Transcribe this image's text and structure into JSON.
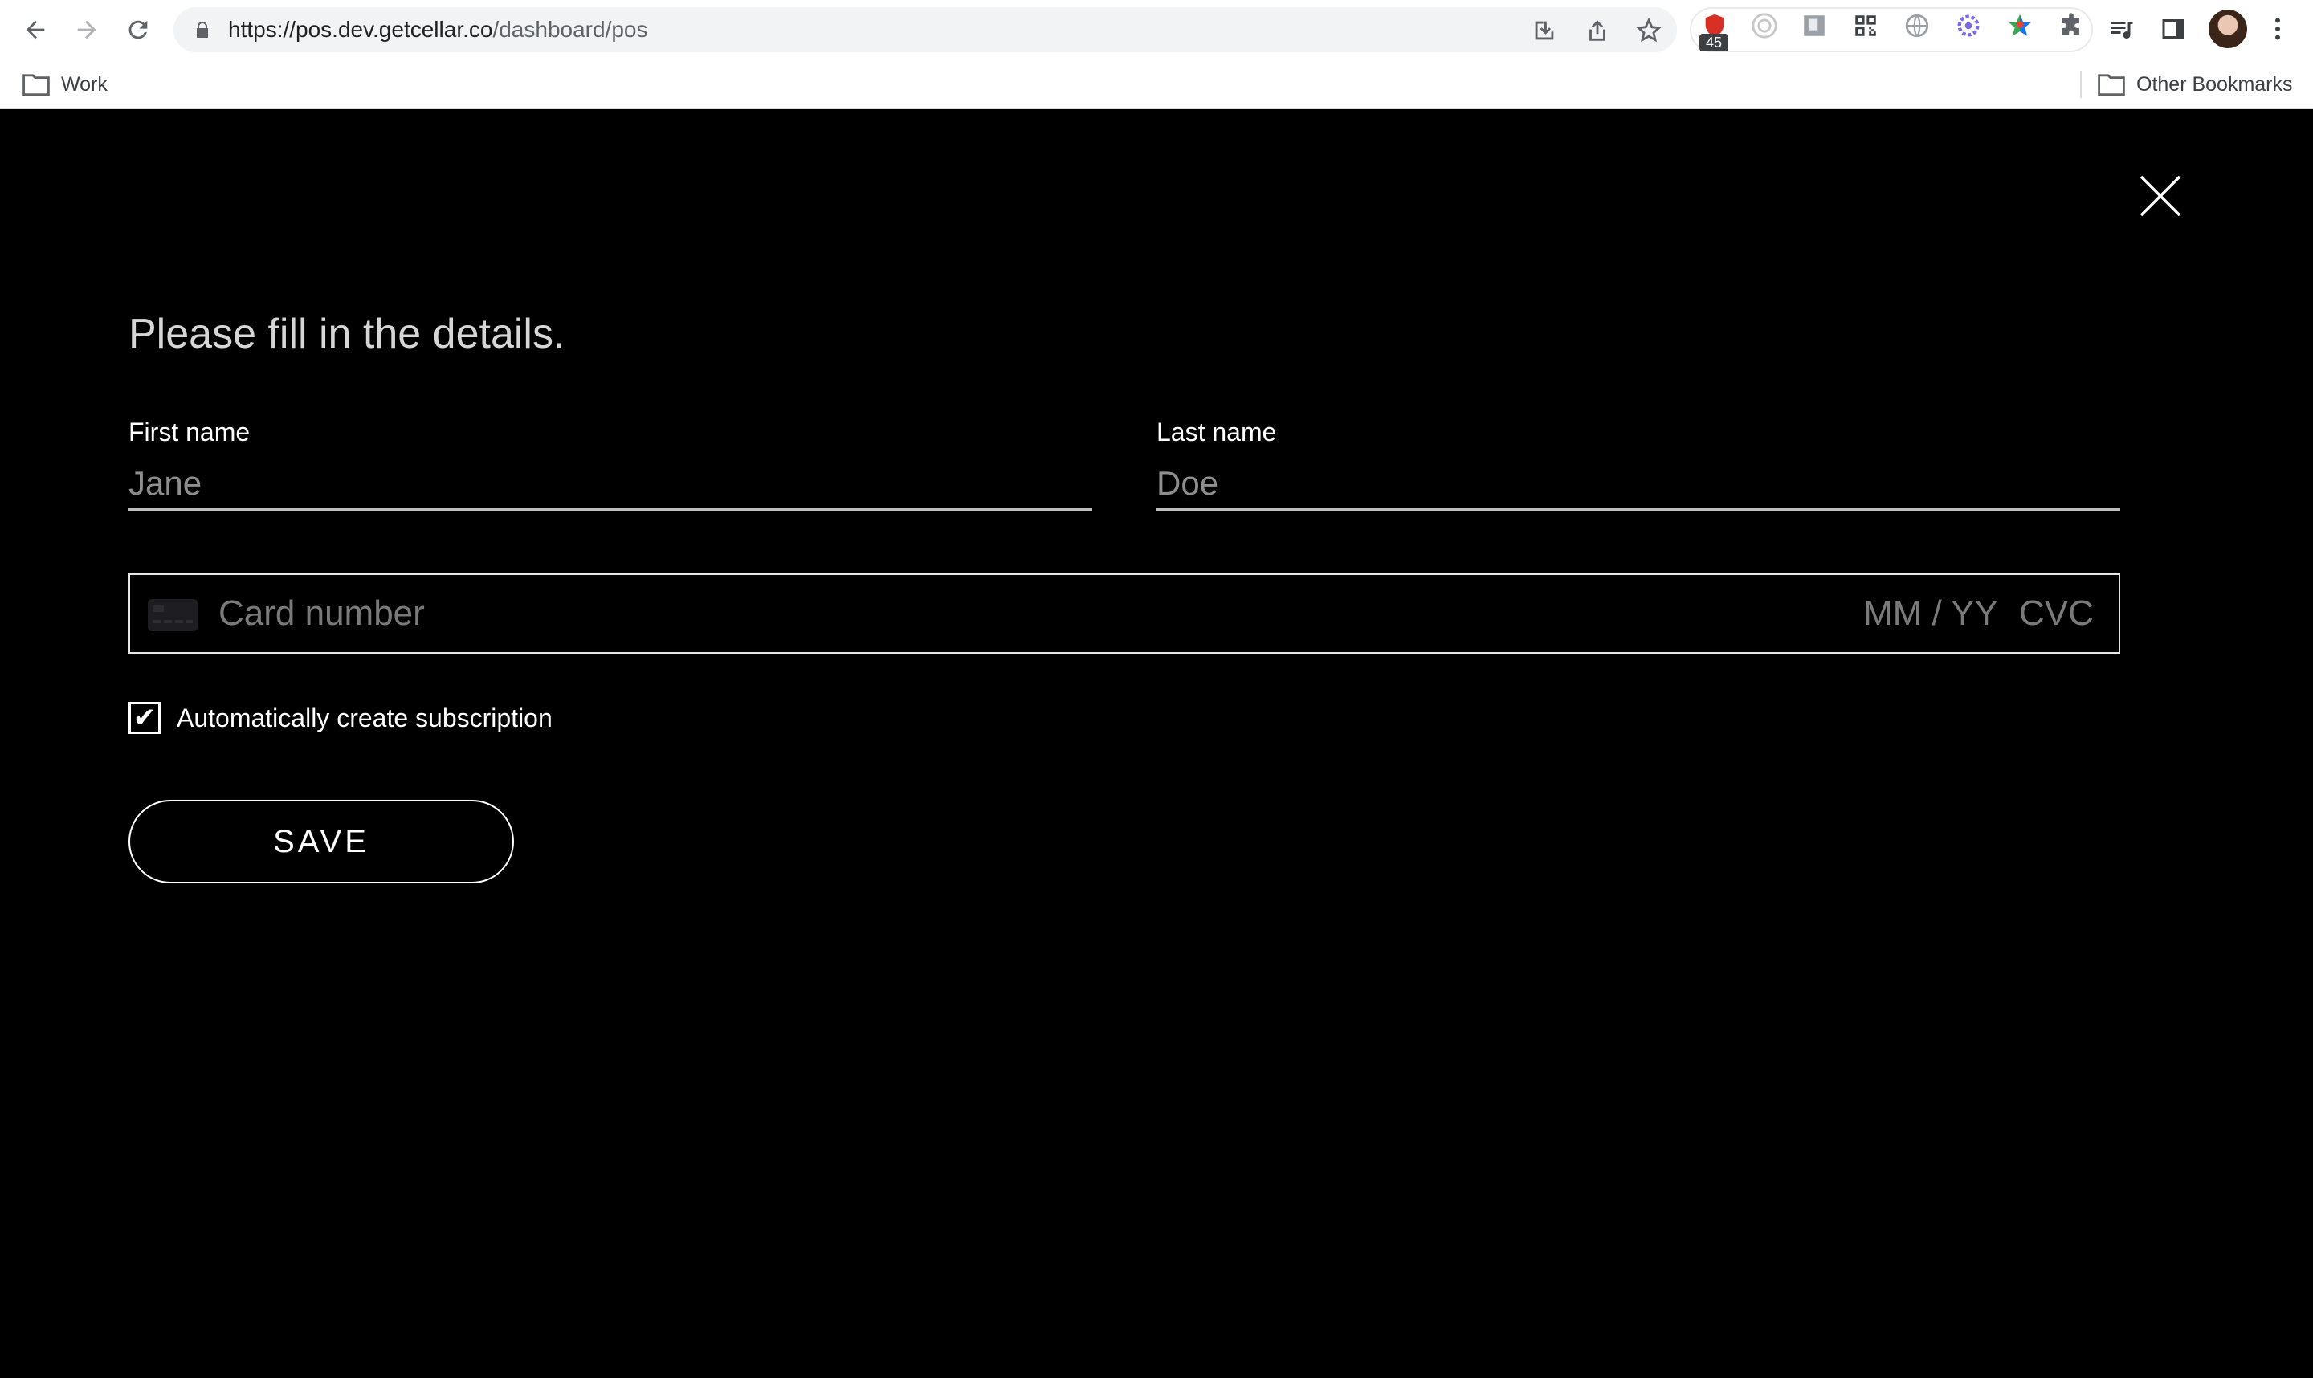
{
  "browser": {
    "url_host": "https://pos.dev.getcellar.co",
    "url_path": "/dashboard/pos",
    "extension_badge": "45",
    "icons": [
      "back-icon",
      "forward-icon",
      "reload-icon",
      "lock-icon",
      "install-icon",
      "share-icon",
      "star-icon",
      "extensions-puzzle-icon",
      "media-icon",
      "side-panel-icon",
      "kebab-menu-icon"
    ]
  },
  "bookmarks": {
    "left_folder": "Work",
    "right_folder": "Other Bookmarks"
  },
  "form": {
    "heading": "Please fill in the details.",
    "first_name_label": "First name",
    "first_name_placeholder": "Jane",
    "last_name_label": "Last name",
    "last_name_placeholder": "Doe",
    "card_number_placeholder": "Card number",
    "card_expiry_placeholder": "MM / YY",
    "card_cvc_placeholder": "CVC",
    "subscription_checked": true,
    "subscription_label": "Automatically create subscription",
    "save_label": "SAVE"
  }
}
